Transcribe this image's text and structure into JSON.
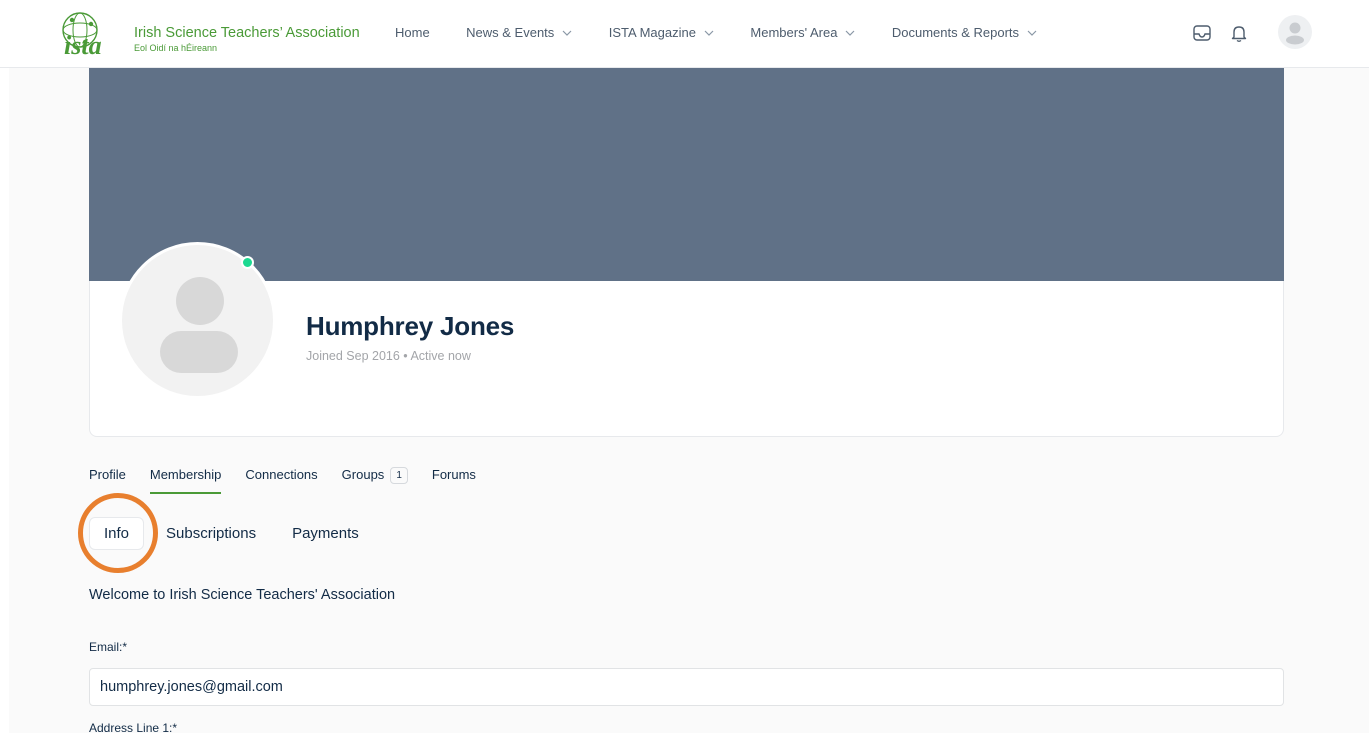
{
  "header": {
    "logo_title": "Irish Science Teachers’ Association",
    "logo_subtitle": "Eol Oidí na hÉireann",
    "nav": [
      {
        "label": "Home",
        "has_dropdown": false
      },
      {
        "label": "News & Events",
        "has_dropdown": true
      },
      {
        "label": "ISTA Magazine",
        "has_dropdown": true
      },
      {
        "label": "Members' Area",
        "has_dropdown": true
      },
      {
        "label": "Documents & Reports",
        "has_dropdown": true
      }
    ],
    "icons": [
      "inbox-icon",
      "bell-icon",
      "user-avatar"
    ]
  },
  "profile": {
    "name": "Humphrey Jones",
    "meta": "Joined Sep 2016 • Active now",
    "status": "online"
  },
  "tabs": [
    {
      "label": "Profile",
      "active": false
    },
    {
      "label": "Membership",
      "active": true
    },
    {
      "label": "Connections",
      "active": false
    },
    {
      "label": "Groups",
      "active": false,
      "count": "1"
    },
    {
      "label": "Forums",
      "active": false
    }
  ],
  "subtabs": [
    {
      "label": "Info",
      "active": true
    },
    {
      "label": "Subscriptions",
      "active": false
    },
    {
      "label": "Payments",
      "active": false
    }
  ],
  "form": {
    "welcome": "Welcome to Irish Science Teachers' Association",
    "email_label": "Email:*",
    "email_value": "humphrey.jones@gmail.com",
    "address_label": "Address Line 1:*"
  },
  "colors": {
    "brand_green": "#4a9a37",
    "cover": "#607187",
    "highlight_ring": "#e87f2e",
    "online": "#1cd991"
  }
}
